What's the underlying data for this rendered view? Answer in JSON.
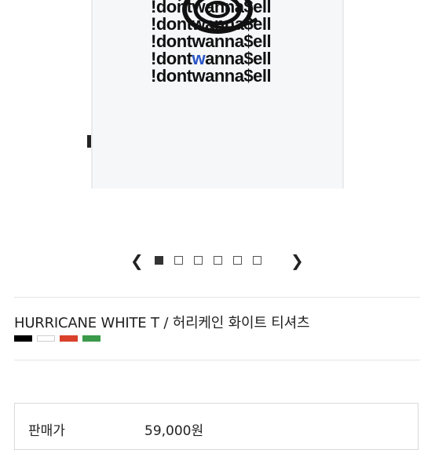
{
  "product": {
    "shirt_print_lines": [
      "!dontwanna$ell",
      "!dontwanna$ell",
      "!dontwanna$ell",
      "!dontwanna$ell",
      "!dontwanna$ell"
    ],
    "title": "HURRICANE WHITE T / 허리케인 화이트 티셔츠",
    "colors": [
      {
        "name": "black",
        "hex": "#000000"
      },
      {
        "name": "white",
        "hex": "#ffffff"
      },
      {
        "name": "red",
        "hex": "#d9412b"
      },
      {
        "name": "green",
        "hex": "#3a9a4a"
      }
    ]
  },
  "slider": {
    "prev_icon": "chevron-left-icon",
    "next_icon": "chevron-right-icon",
    "total_slides": 6,
    "active_index": 0
  },
  "price": {
    "label": "판매가",
    "value": "59,000원"
  }
}
